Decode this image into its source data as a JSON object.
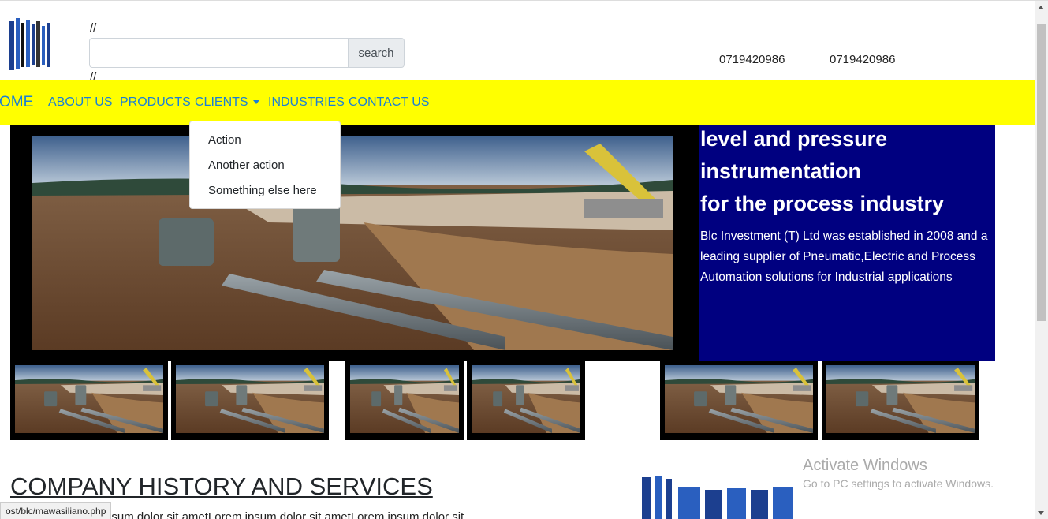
{
  "header": {
    "comment_top": "//",
    "comment_bottom": "//",
    "search": {
      "value": "",
      "placeholder": "",
      "button_label": "search"
    },
    "phones": [
      "0719420986",
      "0719420986"
    ]
  },
  "nav": {
    "items": [
      {
        "label": "HOME",
        "visible_label": "OME"
      },
      {
        "label": "ABOUT US"
      },
      {
        "label": "PRODUCTS"
      },
      {
        "label": "CLIENTS"
      },
      {
        "label": "INDUSTRIES"
      },
      {
        "label": "CONTACT US"
      }
    ],
    "dropdown": [
      "Action",
      "Another action",
      "Something else here"
    ]
  },
  "hero": {
    "title_lines": [
      "level and pressure",
      "instrumentation",
      "for the process industry"
    ],
    "description": "Blc Investment (T) Ltd was established in 2008 and a leading supplier of Pneumatic,Electric and Process Automation solutions for Industrial applications"
  },
  "section": {
    "title": "COMPANY HISTORY AND SERVICES",
    "lorem_visible": "or sit ametLorem ipsum dolor sit ametLorem ipsum dolor sit ametLorem ipsum dolor sit"
  },
  "status_bar": {
    "url": "ost/blc/mawasiliano.php"
  },
  "watermark": {
    "title": "Activate Windows",
    "subtitle": "Go to PC settings to activate Windows."
  },
  "colors": {
    "nav_bg": "#ffff00",
    "nav_text": "#1a7fd6",
    "panel_bg": "#000080"
  },
  "icons": [
    "site-logo",
    "caret-down-icon",
    "scroll-up-icon",
    "scroll-down-icon"
  ]
}
